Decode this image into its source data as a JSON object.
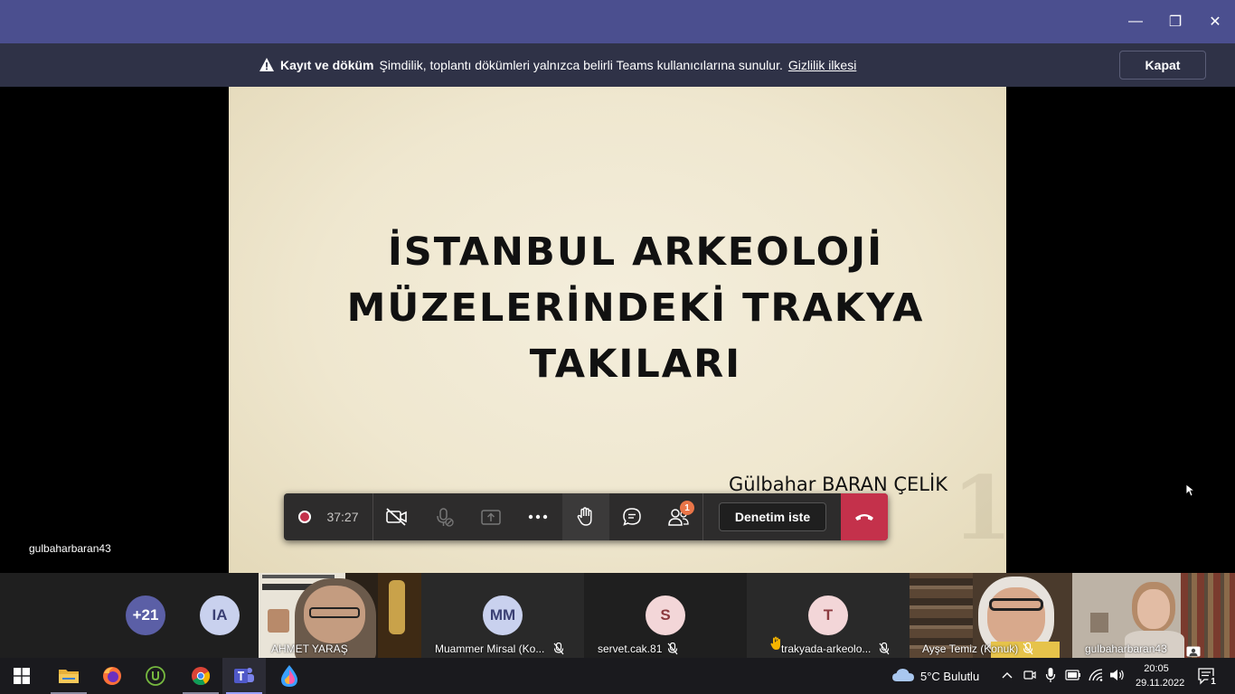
{
  "window": {
    "minimize_glyph": "—",
    "restore_glyph": "❐",
    "close_glyph": "✕"
  },
  "banner": {
    "bold_label": "Kayıt ve döküm",
    "message": "Şimdilik, toplantı dökümleri yalnızca belirli Teams kullanıcılarına sunulur.",
    "link": "Gizlilik ilkesi",
    "close_button": "Kapat",
    "icon": "warning-icon"
  },
  "slide": {
    "title_lines": [
      "İSTANBUL ARKEOLOJİ",
      "MÜZELERİNDEKİ TRAKYA",
      "TAKILARI"
    ],
    "author": "Gülbahar BARAN ÇELİK",
    "page_number": "1"
  },
  "stage": {
    "presenter_label": "gulbaharbaran43"
  },
  "toolbar": {
    "timer": "37:27",
    "participants_badge": "1",
    "request_control": "Denetim iste",
    "icons": [
      "record-icon",
      "camera-off-icon",
      "mic-off-icon",
      "share-icon",
      "more-icon",
      "raise-hand-icon",
      "chat-icon",
      "participants-icon",
      "hangup-icon"
    ]
  },
  "participants": [
    {
      "name": "+21",
      "type": "overflow"
    },
    {
      "name": "IA",
      "type": "initials"
    },
    {
      "name": "AHMET YARAŞ",
      "type": "video"
    },
    {
      "name": "Muammer Mirsal (Ko...",
      "initials": "MM",
      "type": "initials"
    },
    {
      "name": "servet.cak.81",
      "initials": "S",
      "type": "initials"
    },
    {
      "name": "trakyada-arkeolo...",
      "initials": "T",
      "type": "initials",
      "hand_raised": true
    },
    {
      "name": "Ayşe Temiz (Konuk)",
      "type": "video"
    },
    {
      "name": "gulbaharbaran43",
      "type": "video"
    }
  ],
  "taskbar": {
    "weather": "5°C Bulutlu",
    "time": "20:05",
    "date": "29.11.2022",
    "notifications": "1",
    "apps": [
      "windows-start-icon",
      "file-explorer-icon",
      "firefox-icon",
      "utorrent-icon",
      "chrome-icon",
      "teams-icon",
      "paint-drop-icon"
    ]
  }
}
